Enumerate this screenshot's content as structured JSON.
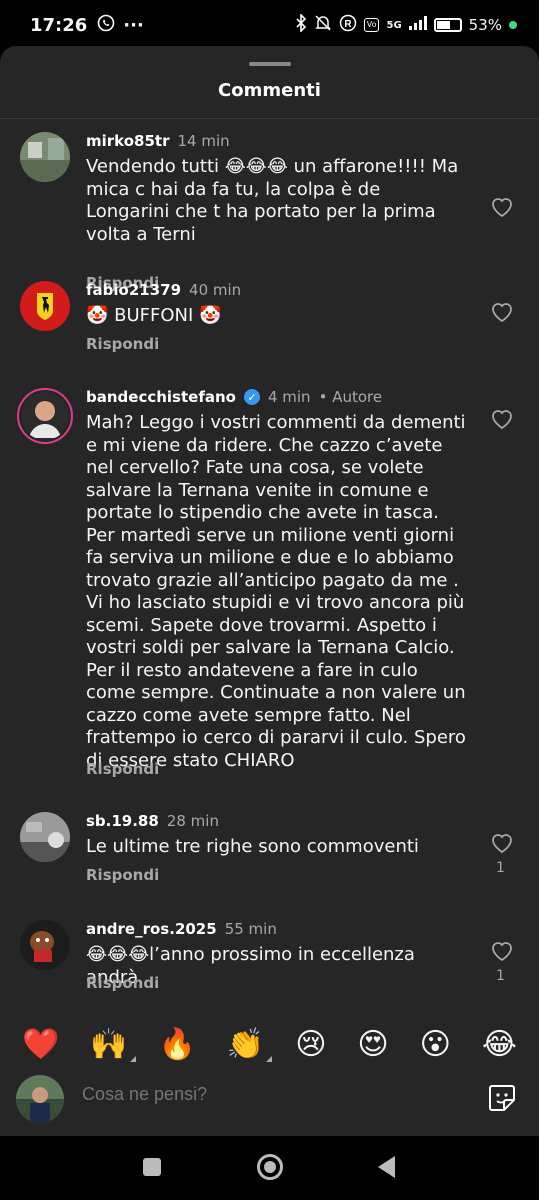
{
  "status_bar": {
    "time": "17:26",
    "network": "5G",
    "battery": "53%"
  },
  "sheet": {
    "title": "Commenti"
  },
  "comments": [
    {
      "user": "mirko85tr",
      "time": "14 min",
      "text": "Vendendo tutti 😂😂😂 un affarone!!!! Ma mica c hai da fa tu, la colpa è de Longarini che t ha portato per la prima volta a Terni",
      "reply": "Rispondi"
    },
    {
      "user": "fabio21379",
      "time": "40 min",
      "text": "🤡 BUFFONI 🤡",
      "reply": "Rispondi"
    },
    {
      "user": "bandecchistefano",
      "time": "4 min",
      "author_tag": "• Autore",
      "text": "Mah? Leggo i vostri commenti da dementi e mi viene da ridere. Che cazzo c’avete nel cervello? Fate una cosa, se volete salvare la Ternana venite in comune e portate lo stipendio che avete in tasca. Per martedì serve un milione venti giorni fa serviva un milione e due e lo abbiamo trovato grazie all’anticipo pagato da me . Vi ho lasciato stupidi e vi trovo ancora più scemi. Sapete dove trovarmi. Aspetto i vostri soldi per salvare la Ternana Calcio. Per il resto andatevene a fare in culo come sempre. Continuate a non valere un cazzo come avete sempre fatto. Nel frattempo io cerco di pararvi il culo. Spero di essere stato CHIARO",
      "reply": "Rispondi"
    },
    {
      "user": "sb.19.88",
      "time": "28 min",
      "text": "Le ultime tre righe sono commoventi",
      "reply": "Rispondi",
      "likes": "1"
    },
    {
      "user": "andre_ros.2025",
      "time": "55 min",
      "text": "😂😂😂l’anno prossimo in eccellenza andrà",
      "reply": "Rispondi",
      "likes": "1"
    }
  ],
  "emoji_bar": [
    "❤️",
    "🙌",
    "🔥",
    "👏",
    "😢",
    "😍",
    "😮",
    "😂"
  ],
  "input": {
    "placeholder": "Cosa ne pensi?"
  },
  "colors": {
    "sheet_bg": "#262626",
    "secondary_text": "#a8a8a8",
    "verified": "#3897f0"
  }
}
